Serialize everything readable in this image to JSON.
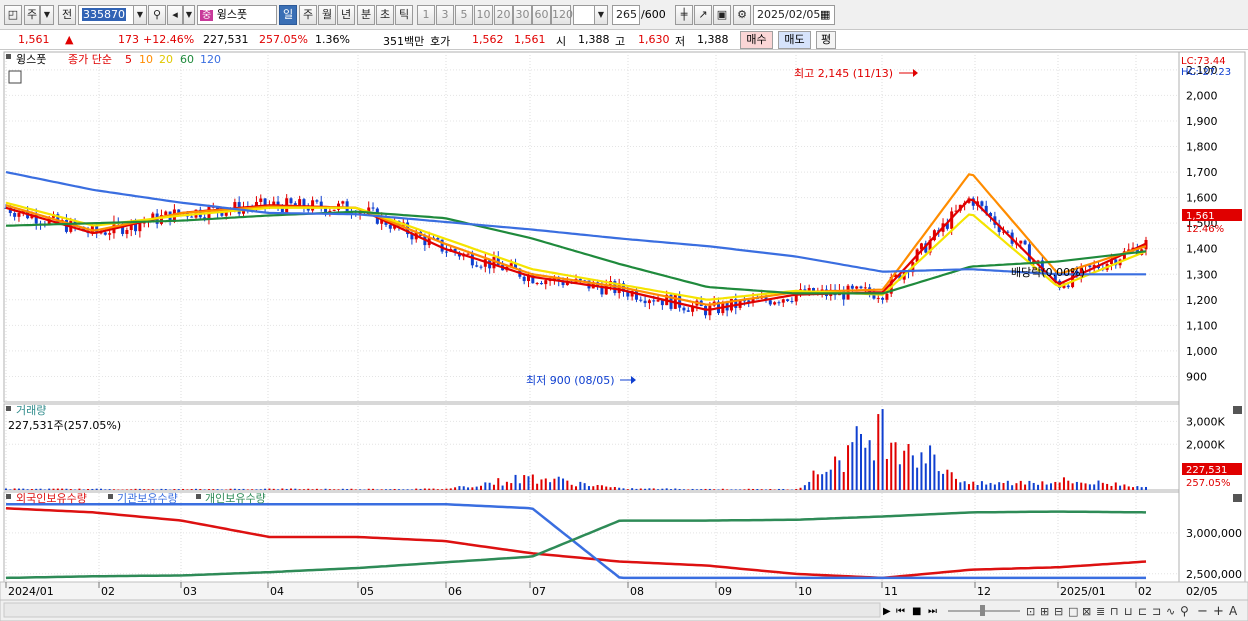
{
  "toolbar": {
    "mode_label": "주",
    "prev_label": "전",
    "stock_code": "335870",
    "stock_name_tag": "중",
    "stock_name": "윙스풋",
    "periods": [
      "일",
      "주",
      "월",
      "년",
      "분",
      "초",
      "틱"
    ],
    "selected_period": "일",
    "intervals": [
      "1",
      "3",
      "5",
      "10",
      "20",
      "30",
      "60",
      "120"
    ],
    "count_value": "265",
    "count_total": "/600",
    "date_value": "2025/02/05"
  },
  "quote": {
    "price": "1,561",
    "change_arrow": "▲",
    "change": "173",
    "change_pct": "+12.46%",
    "volume": "227,531",
    "volume_ratio": "257.05%",
    "turnover": "1.36%",
    "amount": "351백만",
    "bid_ask_label": "호가",
    "ask": "1,562",
    "bid": "1,561",
    "open_label": "시",
    "open": "1,388",
    "high_label": "고",
    "high": "1,630",
    "low_label": "저",
    "low": "1,388",
    "buy_label": "매수",
    "sell_label": "매도",
    "extra_label": "평"
  },
  "price_panel": {
    "symbol": "윙스풋",
    "ma_label": "종가 단순",
    "ma_periods": [
      "5",
      "10",
      "20",
      "60",
      "120"
    ],
    "lc_label": "LC:73.44",
    "hc_label": "HC:-27.23",
    "high_annotation": "최고 2,145 (11/13)",
    "low_annotation": "최저 900 (08/05)",
    "dividend_label": "배당락(0.00%)",
    "current_price_tag": "1,561",
    "current_pct_tag": "12.46%"
  },
  "volume_panel": {
    "title": "거래량",
    "current": "227,531주(257.05%)",
    "tag_value": "227,531",
    "tag_pct": "257.05%"
  },
  "holding_panel": {
    "series_labels": [
      "외국인보유수량",
      "기관보유수량",
      "개인보유수량"
    ]
  },
  "x_axis": [
    "2024/01",
    "02",
    "03",
    "04",
    "05",
    "06",
    "07",
    "08",
    "09",
    "10",
    "11",
    "12",
    "2025/01",
    "02"
  ],
  "x_axis_right": "02/05",
  "colors": {
    "up": "#e00000",
    "down": "#1040d0",
    "ma5": "#e00000",
    "ma10": "#ff8c00",
    "ma20": "#f5e400",
    "ma60": "#1f8a3c",
    "ma120": "#3a6ee0",
    "foreign": "#dd1111",
    "institution": "#3a6ee0",
    "individual": "#2e8b57"
  },
  "chart_data": [
    {
      "type": "line",
      "title": "윙스풋 종가 단순",
      "y_ticks": [
        900,
        1000,
        1100,
        1200,
        1300,
        1400,
        1500,
        1600,
        1700,
        1800,
        1900,
        2000,
        2100
      ],
      "ylim": [
        800,
        2170
      ],
      "x": [
        "2024/01",
        "02",
        "03",
        "04",
        "05",
        "06",
        "07",
        "08",
        "09",
        "10",
        "11",
        "12",
        "2025/01",
        "02/05"
      ],
      "series": [
        {
          "name": "5",
          "values": [
            1560,
            1460,
            1540,
            1570,
            1560,
            1400,
            1290,
            1240,
            1160,
            1220,
            1230,
            1600,
            1260,
            1420
          ]
        },
        {
          "name": "10",
          "values": [
            1570,
            1470,
            1540,
            1565,
            1560,
            1420,
            1300,
            1250,
            1180,
            1230,
            1240,
            1700,
            1300,
            1410
          ]
        },
        {
          "name": "20",
          "values": [
            1580,
            1490,
            1530,
            1560,
            1560,
            1440,
            1320,
            1260,
            1200,
            1235,
            1220,
            1540,
            1250,
            1390
          ]
        },
        {
          "name": "60",
          "values": [
            1490,
            1500,
            1510,
            1530,
            1545,
            1520,
            1440,
            1340,
            1250,
            1225,
            1225,
            1330,
            1350,
            1390
          ]
        },
        {
          "name": "120",
          "values": [
            1700,
            1630,
            1580,
            1540,
            1535,
            1505,
            1475,
            1440,
            1410,
            1370,
            1310,
            1320,
            1300,
            1300
          ]
        }
      ]
    },
    {
      "type": "bar",
      "title": "거래량",
      "y_ticks": [
        "2,000K",
        "3,000K"
      ],
      "ylim": [
        0,
        3500
      ],
      "x": [
        "2024/01",
        "02",
        "03",
        "04",
        "05",
        "06",
        "07",
        "08",
        "09",
        "10",
        "11",
        "12",
        "2025/01",
        "02/05"
      ],
      "values_k": [
        60,
        50,
        40,
        60,
        50,
        60,
        700,
        80,
        50,
        40,
        3400,
        300,
        500,
        227.531
      ]
    },
    {
      "type": "line",
      "title": "보유수량",
      "y_ticks": [
        "2,500,000",
        "3,000,000"
      ],
      "x": [
        "2024/01",
        "02",
        "03",
        "04",
        "05",
        "06",
        "07",
        "08",
        "09",
        "10",
        "11",
        "12",
        "2025/01",
        "02/05"
      ],
      "series": [
        {
          "name": "외국인보유수량",
          "values": [
            3300000,
            3250000,
            3150000,
            2950000,
            2950000,
            2900000,
            2750000,
            2650000,
            2600000,
            2500000,
            2450000,
            2550000,
            2580000,
            2650000
          ]
        },
        {
          "name": "기관보유수량",
          "values": [
            3350000,
            3350000,
            3350000,
            3350000,
            3350000,
            3350000,
            3300000,
            2450000,
            2450000,
            2450000,
            2450000,
            2450000,
            2450000,
            2450000
          ]
        },
        {
          "name": "개인보유수량",
          "values": [
            2450000,
            2470000,
            2480000,
            2520000,
            2570000,
            2640000,
            2710000,
            3150000,
            3150000,
            3160000,
            3200000,
            3250000,
            3260000,
            3250000
          ]
        }
      ]
    }
  ]
}
